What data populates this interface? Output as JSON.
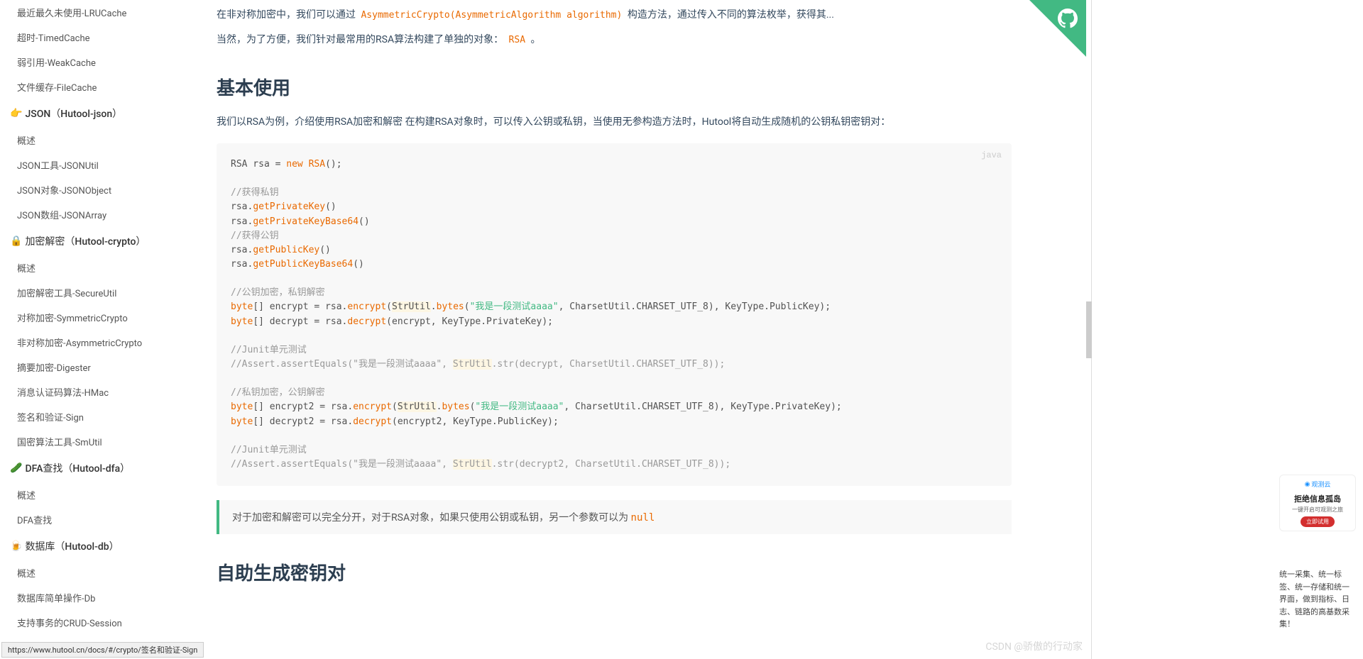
{
  "sidebar": {
    "items_top": [
      "最近最久未使用-LRUCache",
      "超时-TimedCache",
      "弱引用-WeakCache",
      "文件缓存-FileCache"
    ],
    "group_json": {
      "emoji": "👉",
      "label": "JSON（Hutool-json）"
    },
    "items_json": [
      "概述",
      "JSON工具-JSONUtil",
      "JSON对象-JSONObject",
      "JSON数组-JSONArray"
    ],
    "group_crypto": {
      "emoji": "🔒",
      "label": "加密解密（Hutool-crypto）"
    },
    "items_crypto": [
      "概述",
      "加密解密工具-SecureUtil",
      "对称加密-SymmetricCrypto",
      "非对称加密-AsymmetricCrypto",
      "摘要加密-Digester",
      "消息认证码算法-HMac",
      "签名和验证-Sign",
      "国密算法工具-SmUtil"
    ],
    "group_dfa": {
      "emoji": "🥒",
      "label": "DFA查找（Hutool-dfa）"
    },
    "items_dfa": [
      "概述",
      "DFA查找"
    ],
    "group_db": {
      "emoji": "🍺",
      "label": "数据库（Hutool-db）"
    },
    "items_db": [
      "概述",
      "数据库简单操作-Db",
      "支持事务的CRUD-Session"
    ]
  },
  "content": {
    "p1_a": "在非对称加密中，我们可以通过 ",
    "p1_code": "AsymmetricCrypto(AsymmetricAlgorithm algorithm)",
    "p1_b": " 构造方法，通过传入不同的算法枚举，获得其...",
    "p2_a": "当然，为了方便，我们针对最常用的RSA算法构建了单独的对象： ",
    "p2_code": "RSA",
    "p2_b": " 。",
    "h2_basic": "基本使用",
    "p3": "我们以RSA为例，介绍使用RSA加密和解密 在构建RSA对象时，可以传入公钥或私钥，当使用无参构造方法时，Hutool将自动生成随机的公钥私钥密钥对：",
    "code_lang": "java",
    "bq_a": "对于加密和解密可以完全分开，对于RSA对象，如果只使用公钥或私钥，另一个参数可以为 ",
    "bq_code": "null",
    "h2_keygen": "自助生成密钥对"
  },
  "status_url": "https://www.hutool.cn/docs/#/crypto/签名和验证-Sign",
  "watermark": "CSDN @骄傲的行动家",
  "ad": {
    "logo": "观测云",
    "title": "拒绝信息孤岛",
    "sub": "一键开启可观测之旅",
    "btn": "立即试用",
    "text": "统一采集、统一标签、统一存储和统一界面，做到指标、日志、链路的高基数采集！"
  }
}
